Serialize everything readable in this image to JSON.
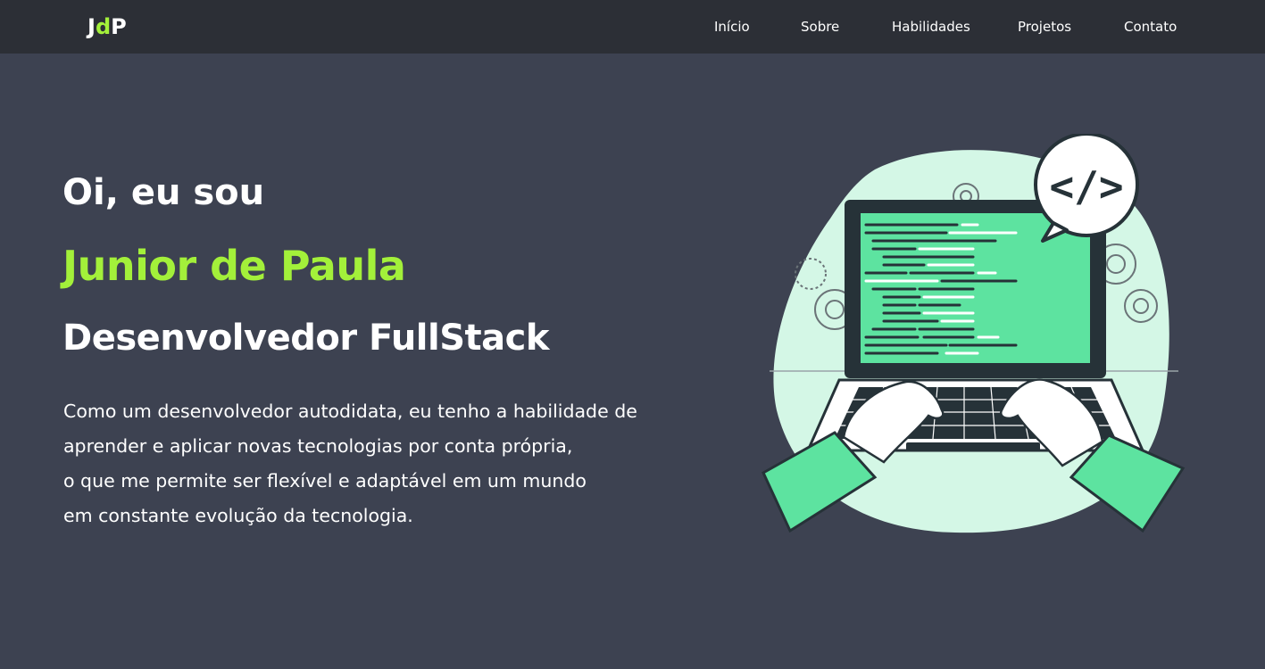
{
  "logo": {
    "part1": "J",
    "part2": "d",
    "part3": "P"
  },
  "nav": {
    "items": [
      {
        "label": "Início"
      },
      {
        "label": "Sobre"
      },
      {
        "label": "Habilidades"
      },
      {
        "label": "Projetos"
      },
      {
        "label": "Contato"
      }
    ]
  },
  "hero": {
    "greeting": "Oi, eu sou",
    "name": "Junior de Paula",
    "role": "Desenvolvedor FullStack",
    "description_lines": [
      "Como um desenvolvedor autodidata, eu tenho a habilidade de",
      "aprender e aplicar novas tecnologias por conta própria,",
      "o que me permite ser flexível e adaptável em um mundo",
      "em constante evolução da tecnologia."
    ],
    "code_bubble": "</>"
  },
  "colors": {
    "background": "#3d4251",
    "navbar": "#2c2f36",
    "accent": "#a3f03a",
    "illustration_green": "#5de3a0",
    "illustration_mint": "#d4f7e6",
    "illustration_dark": "#263238"
  }
}
